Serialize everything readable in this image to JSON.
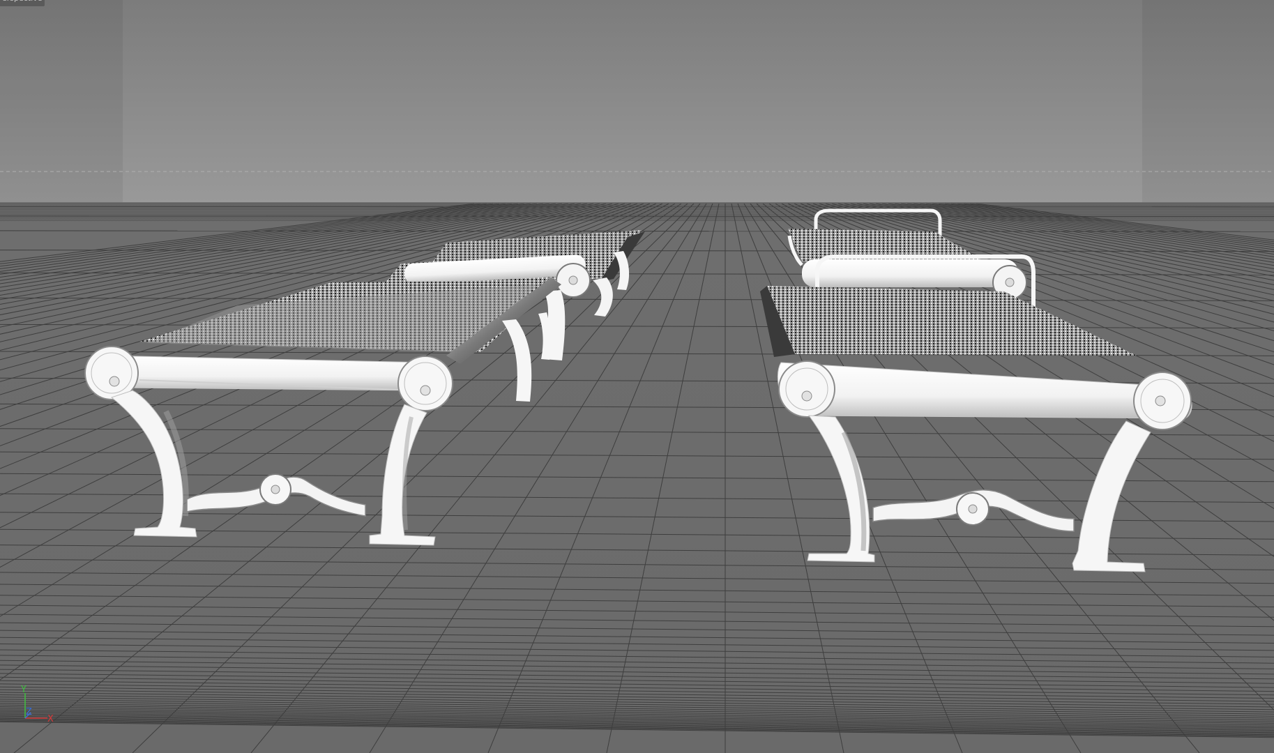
{
  "viewport": {
    "label": "Perspective",
    "visible_label": "erspective",
    "background_top": "#5f5f5f",
    "background_mid": "#8a8a8a",
    "floor_color": "#6c6c6c",
    "grid_color": "#3c3c3c",
    "safe_frame_tint": "#7a7a7a"
  },
  "axis_gizmo": {
    "y_label": "Y",
    "z_label": "Z",
    "x_label": "X",
    "y_color": "#3fbf3f",
    "z_color": "#3a6fd8",
    "x_color": "#d83a3a"
  },
  "scene": {
    "objects": [
      "bench-front-left",
      "bench-back-left",
      "bench-front-right-with-backrest",
      "bench-back-right-with-backrest"
    ]
  }
}
